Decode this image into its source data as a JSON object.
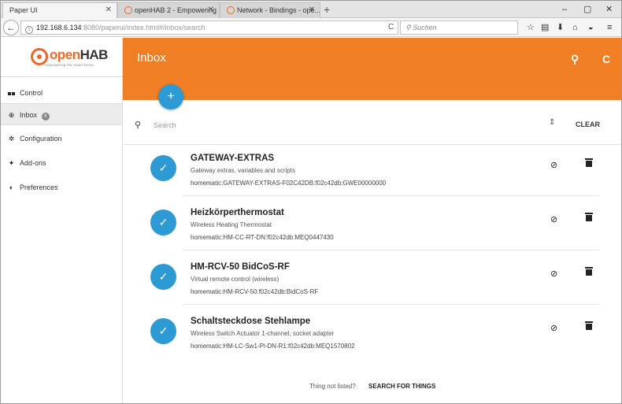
{
  "browser": {
    "tabs": [
      {
        "label": "Paper UI"
      },
      {
        "label": "openHAB 2 - Empowering ..."
      },
      {
        "label": "Network - Bindings - ope..."
      }
    ],
    "url_host": "192.168.6.134",
    "url_path": ":8080/paperui/index.html#/inbox/search",
    "search_placeholder": "Suchen"
  },
  "logo": {
    "open": "open",
    "hab": "HAB",
    "tagline": "empowering the smart home"
  },
  "header": {
    "title": "Inbox"
  },
  "sidebar": {
    "items": [
      {
        "label": "Control",
        "icon": "dashboard-icon"
      },
      {
        "label": "Inbox",
        "icon": "plus-circle-icon",
        "badge": "4"
      },
      {
        "label": "Configuration",
        "icon": "gear-icon"
      },
      {
        "label": "Add-ons",
        "icon": "puzzle-icon"
      },
      {
        "label": "Preferences",
        "icon": "toggle-icon"
      }
    ]
  },
  "search": {
    "placeholder": "Search",
    "clear_label": "CLEAR"
  },
  "things": [
    {
      "title": "GATEWAY-EXTRAS",
      "subtitle": "Gateway extras, variables and scripts",
      "uid": "homematic:GATEWAY-EXTRAS-F02C42DB:f02c42db:GWE00000000"
    },
    {
      "title": "Heizkörperthermostat",
      "subtitle": "Wireless Heating Thermostat",
      "uid": "homematic:HM-CC-RT-DN:f02c42db:MEQ0447430"
    },
    {
      "title": "HM-RCV-50 BidCoS-RF",
      "subtitle": "Virtual remote control (wireless)",
      "uid": "homematic:HM-RCV-50:f02c42db:BidCoS-RF"
    },
    {
      "title": "Schaltsteckdose Stehlampe",
      "subtitle": "Wireless Switch Actuator 1-channel, socket adapter",
      "uid": "homematic:HM-LC-Sw1-Pl-DN-R1:f02c42db:MEQ1570802"
    }
  ],
  "footer": {
    "not_listed": "Thing not listed?",
    "search_things": "SEARCH FOR THINGS"
  },
  "colors": {
    "accent": "#f07e24",
    "primary": "#2d9ad3"
  }
}
